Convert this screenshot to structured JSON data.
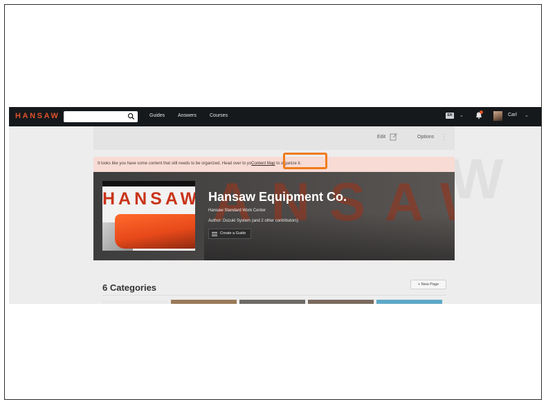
{
  "topnav": {
    "logo": "HANSAW",
    "search_placeholder": "",
    "links": [
      "Guides",
      "Answers",
      "Courses"
    ],
    "language": "EN",
    "user_name": "Carl"
  },
  "toolbar": {
    "edit_label": "Edit",
    "options_label": "Options"
  },
  "notice": {
    "text_before": "It looks like you have some content that still needs to be organized. Head over to yo",
    "link_text": "Content Map",
    "text_after": " to organize it."
  },
  "hero": {
    "watermark": "HANSAW",
    "thumb_logo": "HANSAW",
    "title": "Hansaw Equipment Co.",
    "subtitle": "Hansaw Standard Work Center",
    "author": "Author: Dozuki System (and 2 other contributors)",
    "create_button": "Create a Guide"
  },
  "categories": {
    "title": "6 Categories",
    "new_page_button": "+ New Page",
    "card_colors": [
      "#e9e9e9",
      "#9a7b5a",
      "#6e6a65",
      "#7a6a5e",
      "#5ea9c7"
    ]
  },
  "colors": {
    "accent": "#e0512a",
    "highlight": "#f07b19",
    "notice_bg": "#f8dbd5",
    "nav_bg": "#16191c"
  }
}
